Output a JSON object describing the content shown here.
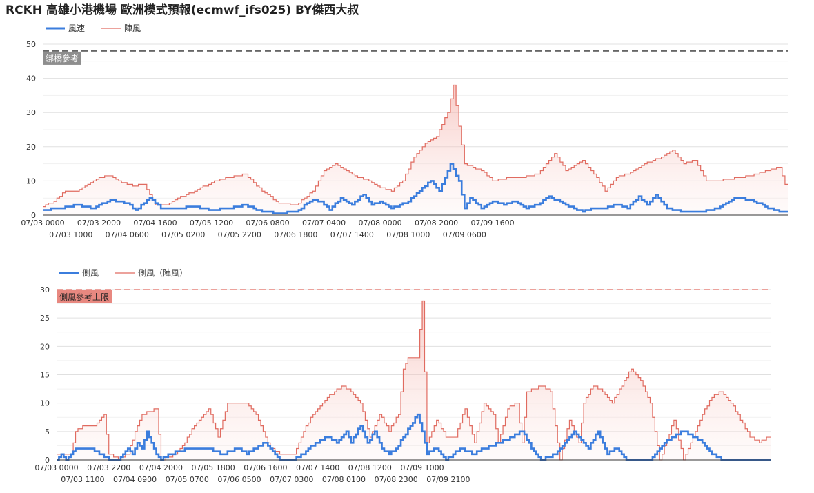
{
  "title": "RCKH 高雄小港機場 歐洲模式預報(ecmwf_ifs025)  BY傑西大叔",
  "chart_data": [
    {
      "type": "area",
      "interval_hours": 1,
      "series": [
        {
          "name": "風速",
          "color": "#3b7ddd",
          "keypoints": [
            [
              0,
              1.5
            ],
            [
              6,
              2
            ],
            [
              12,
              3
            ],
            [
              18,
              2
            ],
            [
              24,
              4.5
            ],
            [
              30,
              3.5
            ],
            [
              33,
              1.5
            ],
            [
              38,
              5
            ],
            [
              42,
              2
            ],
            [
              48,
              2
            ],
            [
              54,
              2.5
            ],
            [
              60,
              1.5
            ],
            [
              66,
              2
            ],
            [
              72,
              3
            ],
            [
              78,
              1
            ],
            [
              84,
              0.5
            ],
            [
              90,
              1
            ],
            [
              96,
              4.5
            ],
            [
              99,
              4
            ],
            [
              102,
              1.5
            ],
            [
              106,
              5
            ],
            [
              110,
              3
            ],
            [
              114,
              6
            ],
            [
              117,
              3
            ],
            [
              120,
              4
            ],
            [
              124,
              2
            ],
            [
              130,
              4
            ],
            [
              135,
              8
            ],
            [
              138,
              10
            ],
            [
              141,
              7
            ],
            [
              145,
              15
            ],
            [
              148,
              10
            ],
            [
              150,
              2
            ],
            [
              152,
              5
            ],
            [
              156,
              2
            ],
            [
              160,
              4
            ],
            [
              164,
              3
            ],
            [
              168,
              4
            ],
            [
              172,
              2
            ],
            [
              176,
              3
            ],
            [
              180,
              5.5
            ],
            [
              186,
              3
            ],
            [
              192,
              1
            ],
            [
              196,
              2
            ],
            [
              200,
              2
            ],
            [
              204,
              3
            ],
            [
              208,
              2
            ],
            [
              212,
              5.5
            ],
            [
              215,
              3
            ],
            [
              218,
              6
            ],
            [
              222,
              2
            ],
            [
              228,
              1
            ],
            [
              234,
              1
            ],
            [
              240,
              2
            ],
            [
              246,
              5
            ],
            [
              252,
              4.5
            ],
            [
              258,
              2
            ],
            [
              263,
              1
            ]
          ]
        },
        {
          "name": "陣風",
          "color": "#e06b60",
          "keypoints": [
            [
              0,
              2.5
            ],
            [
              4,
              4
            ],
            [
              8,
              7
            ],
            [
              12,
              7
            ],
            [
              16,
              9
            ],
            [
              20,
              11
            ],
            [
              24,
              11.5
            ],
            [
              28,
              9.5
            ],
            [
              32,
              8.5
            ],
            [
              36,
              9
            ],
            [
              40,
              3
            ],
            [
              44,
              3
            ],
            [
              48,
              5
            ],
            [
              54,
              7
            ],
            [
              60,
              9.5
            ],
            [
              66,
              11
            ],
            [
              72,
              12
            ],
            [
              78,
              7
            ],
            [
              84,
              3.5
            ],
            [
              90,
              3
            ],
            [
              96,
              7
            ],
            [
              100,
              13
            ],
            [
              104,
              15
            ],
            [
              108,
              13
            ],
            [
              112,
              11
            ],
            [
              116,
              10
            ],
            [
              120,
              8
            ],
            [
              124,
              7
            ],
            [
              128,
              10
            ],
            [
              132,
              17
            ],
            [
              136,
              21
            ],
            [
              140,
              23
            ],
            [
              144,
              30
            ],
            [
              146,
              38
            ],
            [
              148,
              26
            ],
            [
              150,
              15
            ],
            [
              156,
              13
            ],
            [
              160,
              10
            ],
            [
              166,
              11
            ],
            [
              170,
              11
            ],
            [
              176,
              12
            ],
            [
              182,
              18
            ],
            [
              186,
              13
            ],
            [
              192,
              16
            ],
            [
              196,
              12
            ],
            [
              200,
              7
            ],
            [
              204,
              11
            ],
            [
              208,
              12
            ],
            [
              214,
              15
            ],
            [
              220,
              17
            ],
            [
              224,
              19
            ],
            [
              228,
              15
            ],
            [
              232,
              16
            ],
            [
              236,
              10
            ],
            [
              240,
              10
            ],
            [
              248,
              11
            ],
            [
              254,
              12
            ],
            [
              258,
              13
            ],
            [
              262,
              14
            ],
            [
              264,
              9
            ]
          ]
        }
      ],
      "x_tick_labels": [
        "07/03 0000",
        "07/03 1000",
        "07/03 2000",
        "07/04 0600",
        "07/04 1600",
        "07/05 0200",
        "07/05 1200",
        "07/05 2200",
        "07/06 0800",
        "07/06 1800",
        "07/07 0400",
        "07/07 1400",
        "07/08 0000",
        "07/08 1000",
        "07/08 2000",
        "07/09 0600",
        "07/09 1600"
      ],
      "ylim": [
        0,
        50
      ],
      "y_ticks": [
        0,
        10,
        20,
        30,
        40,
        50
      ],
      "grid": true,
      "legend_position": "top-left",
      "reference_line": {
        "value": 48,
        "label": "綁橋參考",
        "color": "#333333",
        "label_bg": "#8e8e8e"
      }
    },
    {
      "type": "area",
      "interval_hours": 1,
      "series": [
        {
          "name": "側風",
          "color": "#3b7ddd",
          "keypoints": [
            [
              0,
              0
            ],
            [
              2,
              1
            ],
            [
              4,
              0
            ],
            [
              8,
              2
            ],
            [
              14,
              2
            ],
            [
              18,
              1
            ],
            [
              22,
              0
            ],
            [
              26,
              0
            ],
            [
              30,
              2
            ],
            [
              32,
              1
            ],
            [
              34,
              3
            ],
            [
              36,
              2
            ],
            [
              38,
              5
            ],
            [
              40,
              3
            ],
            [
              42,
              1
            ],
            [
              44,
              0
            ],
            [
              48,
              1
            ],
            [
              56,
              2
            ],
            [
              64,
              2
            ],
            [
              70,
              1
            ],
            [
              76,
              2
            ],
            [
              80,
              1
            ],
            [
              84,
              2
            ],
            [
              88,
              3
            ],
            [
              90,
              2
            ],
            [
              94,
              0
            ],
            [
              100,
              0
            ],
            [
              104,
              1
            ],
            [
              106,
              2
            ],
            [
              110,
              3
            ],
            [
              114,
              4
            ],
            [
              118,
              3
            ],
            [
              122,
              5
            ],
            [
              124,
              3
            ],
            [
              128,
              6
            ],
            [
              131,
              3
            ],
            [
              134,
              5
            ],
            [
              137,
              2
            ],
            [
              140,
              1
            ],
            [
              143,
              2
            ],
            [
              146,
              4
            ],
            [
              149,
              6
            ],
            [
              152,
              8
            ],
            [
              154,
              5
            ],
            [
              156,
              1
            ],
            [
              160,
              2
            ],
            [
              164,
              0
            ],
            [
              170,
              2
            ],
            [
              176,
              1
            ],
            [
              180,
              2
            ],
            [
              186,
              3
            ],
            [
              192,
              4
            ],
            [
              196,
              5
            ],
            [
              200,
              2
            ],
            [
              204,
              0
            ],
            [
              210,
              1
            ],
            [
              214,
              3
            ],
            [
              218,
              5
            ],
            [
              222,
              3
            ],
            [
              224,
              2
            ],
            [
              228,
              5
            ],
            [
              232,
              1
            ],
            [
              236,
              2
            ],
            [
              240,
              0
            ],
            [
              250,
              0
            ],
            [
              256,
              3
            ],
            [
              260,
              4
            ],
            [
              264,
              5
            ],
            [
              268,
              4
            ],
            [
              272,
              3
            ],
            [
              276,
              1
            ],
            [
              280,
              0
            ]
          ]
        },
        {
          "name": "側風（陣風）",
          "color": "#e06b60",
          "keypoints": [
            [
              0,
              1
            ],
            [
              6,
              1
            ],
            [
              8,
              5
            ],
            [
              12,
              6
            ],
            [
              16,
              6
            ],
            [
              20,
              8
            ],
            [
              22,
              1
            ],
            [
              26,
              0
            ],
            [
              30,
              1
            ],
            [
              34,
              6
            ],
            [
              36,
              8
            ],
            [
              42,
              9
            ],
            [
              44,
              0
            ],
            [
              50,
              1
            ],
            [
              54,
              3
            ],
            [
              58,
              6
            ],
            [
              64,
              9
            ],
            [
              68,
              4
            ],
            [
              72,
              10
            ],
            [
              76,
              10
            ],
            [
              80,
              10
            ],
            [
              84,
              8
            ],
            [
              88,
              4
            ],
            [
              90,
              2
            ],
            [
              94,
              1
            ],
            [
              100,
              1
            ],
            [
              104,
              5
            ],
            [
              108,
              8
            ],
            [
              114,
              11
            ],
            [
              120,
              13
            ],
            [
              124,
              12
            ],
            [
              128,
              10
            ],
            [
              132,
              4
            ],
            [
              136,
              8
            ],
            [
              140,
              5
            ],
            [
              144,
              8
            ],
            [
              146,
              16
            ],
            [
              148,
              18
            ],
            [
              152,
              18
            ],
            [
              154,
              28
            ],
            [
              156,
              3
            ],
            [
              160,
              7
            ],
            [
              164,
              4
            ],
            [
              168,
              4
            ],
            [
              172,
              9
            ],
            [
              176,
              3
            ],
            [
              180,
              10
            ],
            [
              184,
              8
            ],
            [
              186,
              3
            ],
            [
              190,
              9
            ],
            [
              194,
              10
            ],
            [
              196,
              3
            ],
            [
              198,
              12
            ],
            [
              204,
              13
            ],
            [
              208,
              12
            ],
            [
              212,
              0
            ],
            [
              216,
              7
            ],
            [
              220,
              3
            ],
            [
              222,
              10
            ],
            [
              226,
              13
            ],
            [
              230,
              12
            ],
            [
              234,
              10
            ],
            [
              238,
              13
            ],
            [
              242,
              16
            ],
            [
              246,
              14
            ],
            [
              250,
              10
            ],
            [
              254,
              0
            ],
            [
              260,
              7
            ],
            [
              264,
              0
            ],
            [
              268,
              4
            ],
            [
              272,
              8
            ],
            [
              276,
              11
            ],
            [
              280,
              12
            ],
            [
              284,
              10
            ],
            [
              288,
              7
            ],
            [
              292,
              4
            ],
            [
              296,
              3
            ],
            [
              300,
              4
            ]
          ]
        }
      ],
      "x_tick_labels": [
        "07/03 0000",
        "07/03 1100",
        "07/03 2200",
        "07/04 0900",
        "07/04 2000",
        "07/05 0700",
        "07/05 1800",
        "07/06 0500",
        "07/06 1600",
        "07/07 0300",
        "07/07 1400",
        "07/08 0100",
        "07/08 1200",
        "07/08 2300",
        "07/09 1000",
        "07/09 2100"
      ],
      "ylim": [
        0,
        30
      ],
      "y_ticks": [
        0,
        5,
        10,
        15,
        20,
        25,
        30
      ],
      "grid": true,
      "legend_position": "top-left",
      "reference_line": {
        "value": 30,
        "label": "側風參考上限",
        "color": "#e06b60",
        "label_bg": "#e88880"
      }
    }
  ]
}
